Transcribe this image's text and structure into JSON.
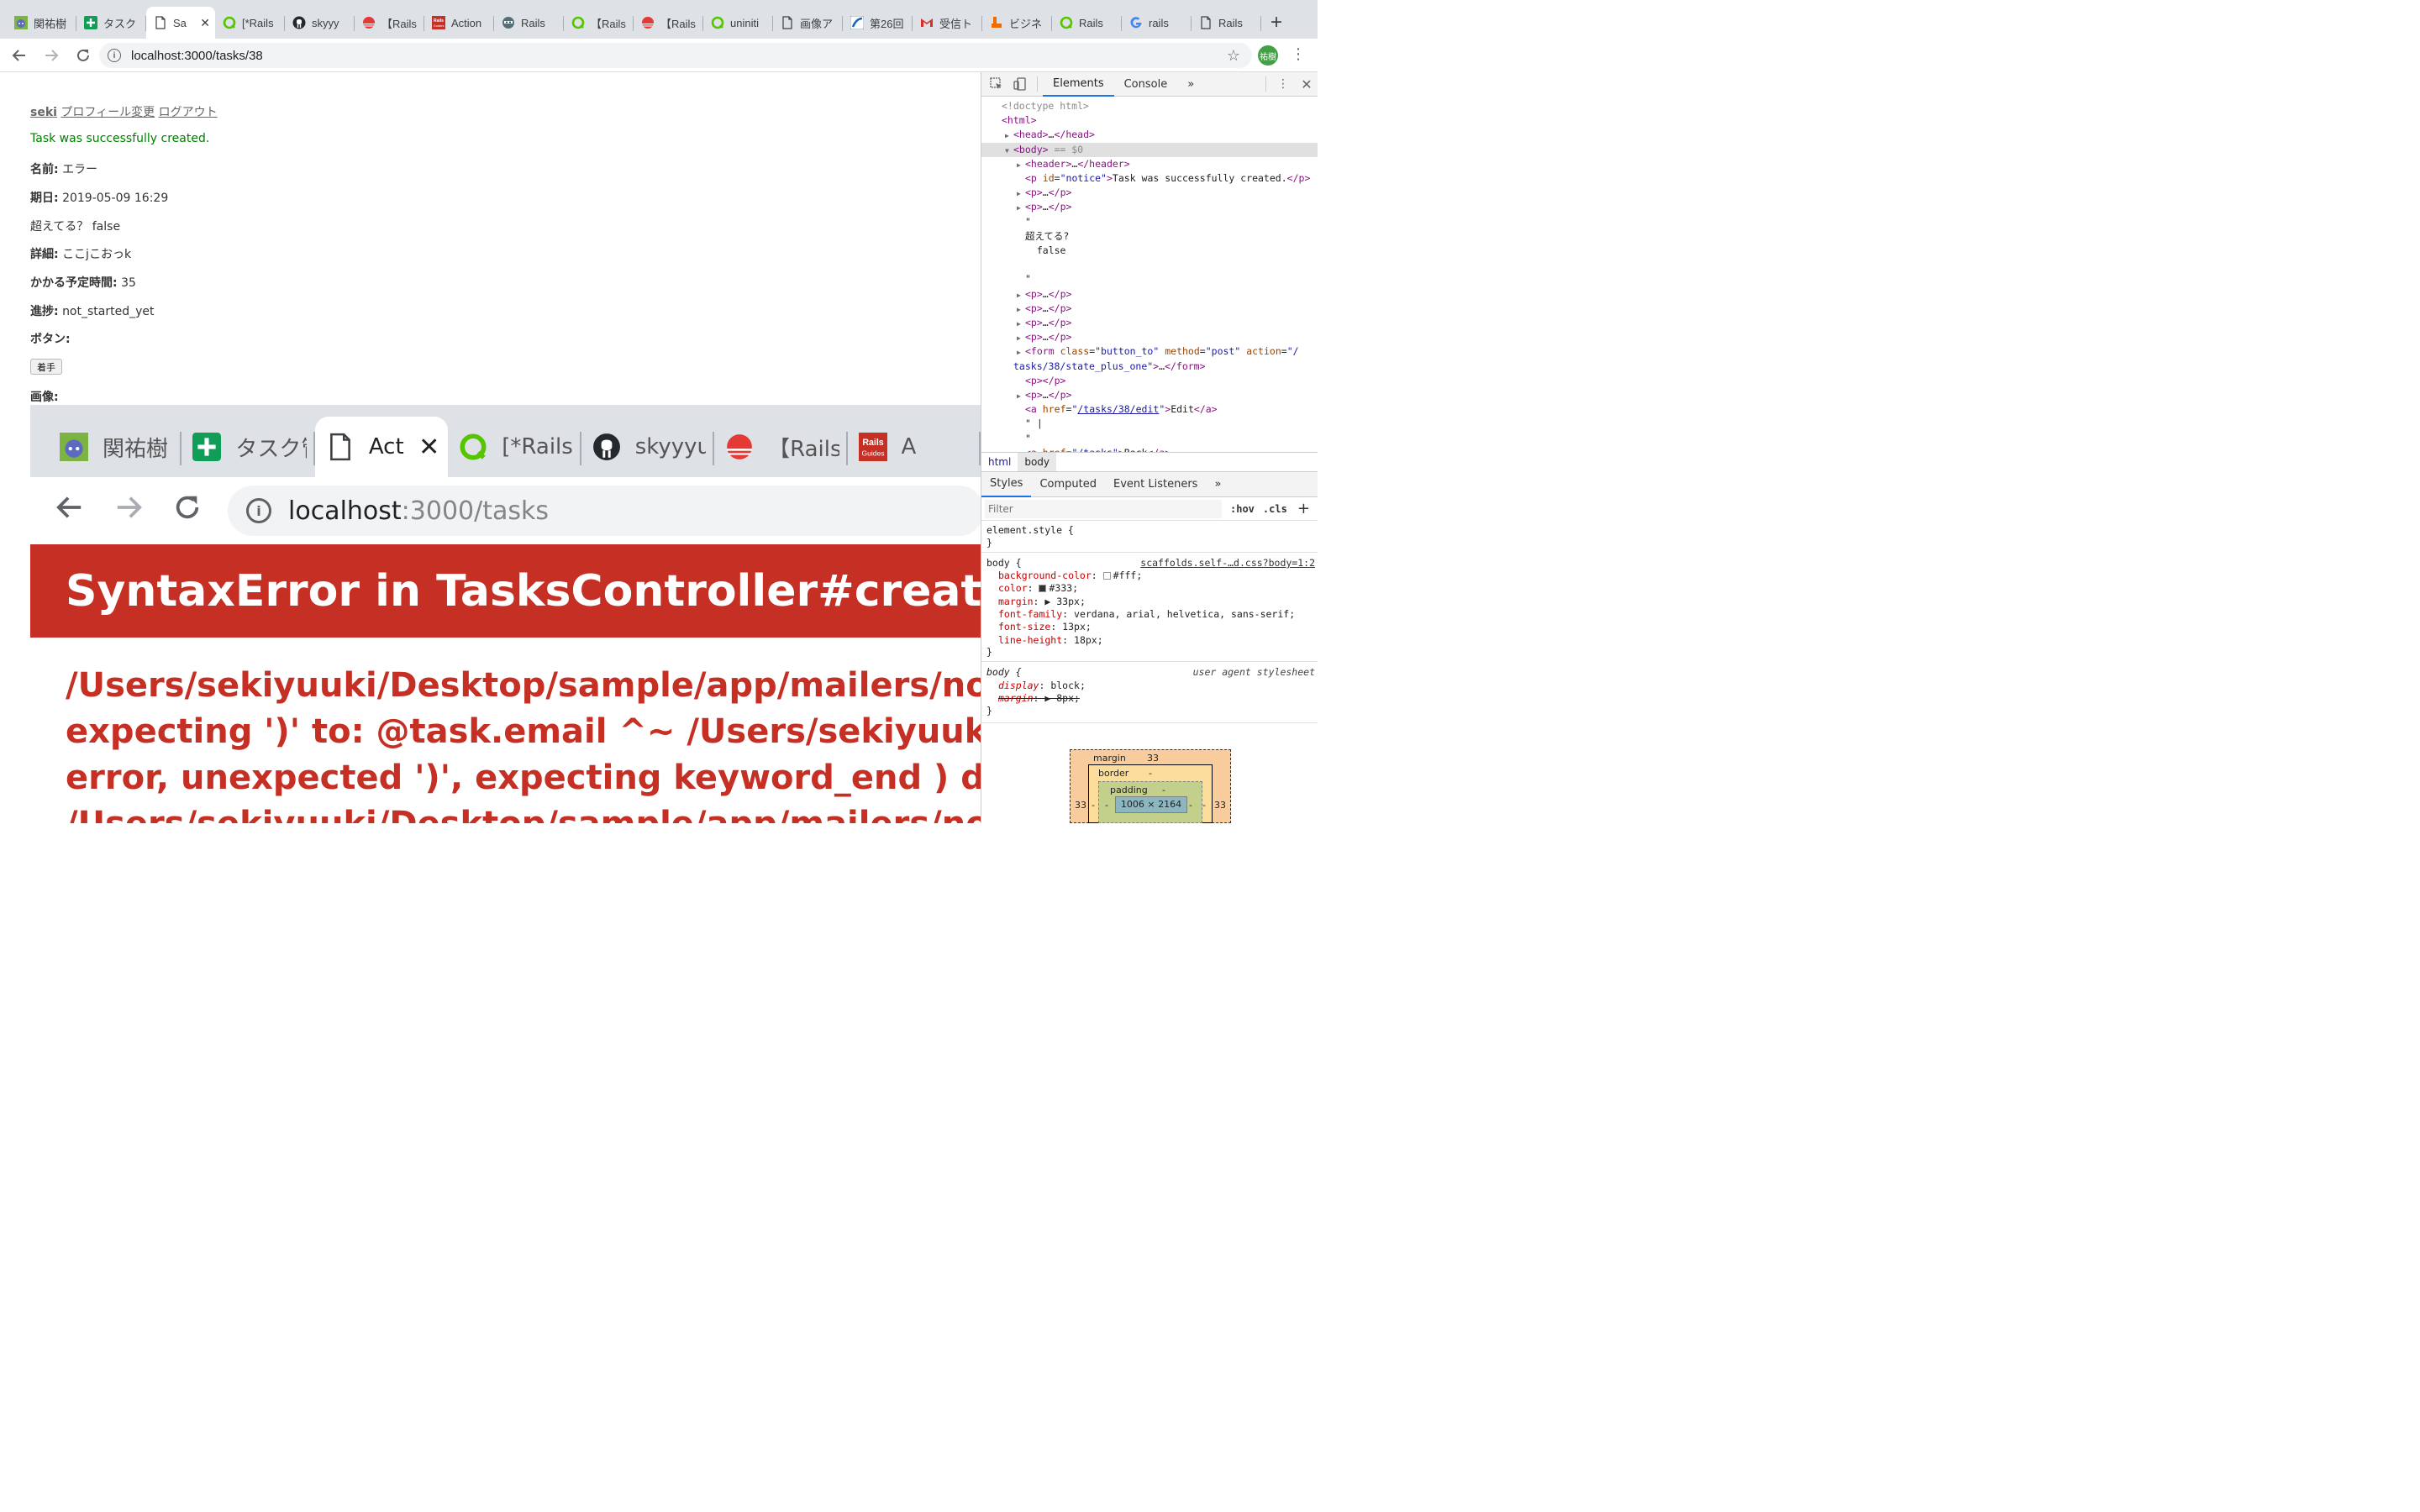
{
  "browser": {
    "tabs": [
      {
        "title": "関祐樹",
        "icon": "cat-avatar-icon",
        "color": "#7cb342"
      },
      {
        "title": "タスク",
        "icon": "green-plus-icon",
        "color": "#0f9d58"
      },
      {
        "title": "Sa",
        "icon": "document-icon",
        "active": true
      },
      {
        "title": "[*Rails",
        "icon": "qiita-icon",
        "color": "#55c500"
      },
      {
        "title": "skyyy",
        "icon": "github-icon",
        "color": "#24292e"
      },
      {
        "title": "【Rails",
        "icon": "red-sun-icon",
        "color": "#e53935"
      },
      {
        "title": "Action",
        "icon": "rails-guides-icon",
        "color": "#c52f24"
      },
      {
        "title": "Rails",
        "icon": "ninja-icon",
        "color": "#546e7a"
      },
      {
        "title": "【Rails",
        "icon": "qiita-icon",
        "color": "#55c500"
      },
      {
        "title": "【Rails",
        "icon": "red-sun-icon",
        "color": "#e53935"
      },
      {
        "title": "uniniti",
        "icon": "qiita-icon",
        "color": "#55c500"
      },
      {
        "title": "画像ア",
        "icon": "document-icon"
      },
      {
        "title": "第26回",
        "icon": "blue-swoosh-icon",
        "color": "#1565c0"
      },
      {
        "title": "受信ト",
        "icon": "gmail-icon",
        "color": "#d93025"
      },
      {
        "title": "ビジネ",
        "icon": "boot-icon",
        "color": "#ef6c00"
      },
      {
        "title": "Rails",
        "icon": "qiita-icon",
        "color": "#55c500"
      },
      {
        "title": "rails",
        "icon": "google-icon",
        "color": "#4285f4"
      },
      {
        "title": "Rails",
        "icon": "document-icon"
      }
    ],
    "close_glyph": "✕",
    "new_tab": "+",
    "url": "localhost:3000/tasks/38",
    "profile_initials": "祐樹"
  },
  "page": {
    "header": {
      "username": "seki",
      "profile_link": "プロフィール変更",
      "logout_link": "ログアウト"
    },
    "notice": "Task was successfully created.",
    "fields": [
      {
        "label": "名前:",
        "value": "エラー"
      },
      {
        "label": "期日:",
        "value": "2019-05-09 16:29"
      }
    ],
    "overdue_text": "超えてる？ false",
    "fields2": [
      {
        "label": "詳細:",
        "value": "ここjこおっk"
      },
      {
        "label": "かかる予定時間:",
        "value": "35"
      },
      {
        "label": "進捗:",
        "value": "not_started_yet"
      },
      {
        "label": "ボタン:",
        "value": ""
      }
    ],
    "state_button": "着手",
    "image_label": "画像:"
  },
  "screenshot": {
    "tabs": [
      {
        "title": "関祐樹 |",
        "icon": "cat-avatar-icon"
      },
      {
        "title": "タスク管",
        "icon": "green-plus-icon"
      },
      {
        "title": "Act",
        "icon": "document-icon",
        "active": true
      },
      {
        "title": "[*Rails",
        "icon": "qiita-icon"
      },
      {
        "title": "skyyyu",
        "icon": "github-icon"
      },
      {
        "title": "【Rails",
        "icon": "red-sun-icon"
      },
      {
        "title": "A",
        "icon": "rails-guides-icon"
      }
    ],
    "url_host": "localhost",
    "url_rest": ":3000/tasks",
    "error_title": "SyntaxError in TasksController#create",
    "error_lines": [
      "/Users/sekiyuuki/Desktop/sample/app/mailers/notificat",
      "expecting ')' to: @task.email ^~ /Users/sekiyuuki/Desk",
      "error, unexpected ')', expecting keyword_end ) do |forr",
      "/Users/sekiyuuki/Desktop/sample/app/mailers/notificat"
    ]
  },
  "devtools": {
    "tabs": [
      "Elements",
      "Console"
    ],
    "more": "»",
    "dom": [
      {
        "indent": 0,
        "tri": "",
        "html": "<span class='cm'>&lt;!doctype html&gt;</span>"
      },
      {
        "indent": 0,
        "tri": "",
        "html": "<span class='tg'>&lt;html&gt;</span>"
      },
      {
        "indent": 1,
        "tri": "▶",
        "html": "<span class='tg'>&lt;head&gt;</span>…<span class='tg'>&lt;/head&gt;</span>"
      },
      {
        "indent": 1,
        "tri": "▼",
        "sel": true,
        "html": "<span class='tg'>&lt;body&gt;</span> <span class='cm'>== $0</span>"
      },
      {
        "indent": 2,
        "tri": "▶",
        "html": "<span class='tg'>&lt;header&gt;</span>…<span class='tg'>&lt;/header&gt;</span>"
      },
      {
        "indent": 2,
        "tri": "",
        "html": "<span class='tg'>&lt;p</span> <span class='at'>id</span>=<span class='av'>\"notice\"</span><span class='tg'>&gt;</span>Task was successfully created.<span class='tg'>&lt;/p&gt;</span>"
      },
      {
        "indent": 2,
        "tri": "▶",
        "html": "<span class='tg'>&lt;p&gt;</span>…<span class='tg'>&lt;/p&gt;</span>"
      },
      {
        "indent": 2,
        "tri": "▶",
        "html": "<span class='tg'>&lt;p&gt;</span>…<span class='tg'>&lt;/p&gt;</span>"
      },
      {
        "indent": 2,
        "tri": "",
        "html": "\""
      },
      {
        "indent": 2,
        "tri": "",
        "html": "超えてる?"
      },
      {
        "indent": 2,
        "tri": "",
        "html": "&nbsp;&nbsp;false"
      },
      {
        "indent": 2,
        "tri": "",
        "html": ""
      },
      {
        "indent": 2,
        "tri": "",
        "html": "\""
      },
      {
        "indent": 2,
        "tri": "▶",
        "html": "<span class='tg'>&lt;p&gt;</span>…<span class='tg'>&lt;/p&gt;</span>"
      },
      {
        "indent": 2,
        "tri": "▶",
        "html": "<span class='tg'>&lt;p&gt;</span>…<span class='tg'>&lt;/p&gt;</span>"
      },
      {
        "indent": 2,
        "tri": "▶",
        "html": "<span class='tg'>&lt;p&gt;</span>…<span class='tg'>&lt;/p&gt;</span>"
      },
      {
        "indent": 2,
        "tri": "▶",
        "html": "<span class='tg'>&lt;p&gt;</span>…<span class='tg'>&lt;/p&gt;</span>"
      },
      {
        "indent": 2,
        "tri": "▶",
        "html": "<span class='tg'>&lt;form</span> <span class='at'>class</span>=<span class='av'>\"button_to\"</span> <span class='at'>method</span>=<span class='av'>\"post\"</span> <span class='at'>action</span>=<span class='av'>\"/</span>"
      },
      {
        "indent": 1,
        "tri": "",
        "html": "<span class='av'>tasks/38/state_plus_one\"</span><span class='tg'>&gt;</span>…<span class='tg'>&lt;/form&gt;</span>"
      },
      {
        "indent": 2,
        "tri": "",
        "html": "<span class='tg'>&lt;p&gt;&lt;/p&gt;</span>"
      },
      {
        "indent": 2,
        "tri": "▶",
        "html": "<span class='tg'>&lt;p&gt;</span>…<span class='tg'>&lt;/p&gt;</span>"
      },
      {
        "indent": 2,
        "tri": "",
        "html": "<span class='tg'>&lt;a</span> <span class='at'>href</span>=<span class='av'>\"</span><span class='lnk'>/tasks/38/edit</span><span class='av'>\"</span><span class='tg'>&gt;</span>Edit<span class='tg'>&lt;/a&gt;</span>"
      },
      {
        "indent": 2,
        "tri": "",
        "html": "\" |"
      },
      {
        "indent": 2,
        "tri": "",
        "html": "\""
      },
      {
        "indent": 2,
        "tri": "",
        "html": "<span class='tg'>&lt;a</span> <span class='at'>href</span>=<span class='av'>\"/tasks\"</span><span class='tg'>&gt;</span>Back<span class='tg'>&lt;/a&gt;</span>"
      }
    ],
    "breadcrumbs": [
      "html",
      "body"
    ],
    "sub_tabs": [
      "Styles",
      "Computed",
      "Event Listeners"
    ],
    "filter_placeholder": "Filter",
    "hov": ":hov",
    "cls": ".cls",
    "add": "+",
    "element_style": "element.style {",
    "close_brace": "}",
    "rule1": {
      "selector": "body {",
      "source": "scaffolds.self-…d.css?body=1:2",
      "props": [
        {
          "name": "background-color",
          "value": "#fff;",
          "swatch": "#ffffff"
        },
        {
          "name": "color",
          "value": "#333;",
          "swatch": "#333333"
        },
        {
          "name": "margin",
          "value": "▶ 33px;"
        },
        {
          "name": "font-family",
          "value": "verdana, arial, helvetica, sans-serif;"
        },
        {
          "name": "font-size",
          "value": "13px;"
        },
        {
          "name": "line-height",
          "value": "18px;"
        }
      ]
    },
    "rule2": {
      "selector": "body {",
      "source": "user agent stylesheet",
      "props": [
        {
          "name": "display",
          "value": "block;"
        },
        {
          "name": "margin",
          "value": "▶ 8px;",
          "struck": true
        }
      ]
    },
    "boxmodel": {
      "margin_label": "margin",
      "margin_value": "33",
      "border_label": "border",
      "border_value": "-",
      "padding_label": "padding",
      "padding_value": "-",
      "content": "1006 × 2164",
      "side_margin": "33",
      "side_dash": "-"
    }
  }
}
